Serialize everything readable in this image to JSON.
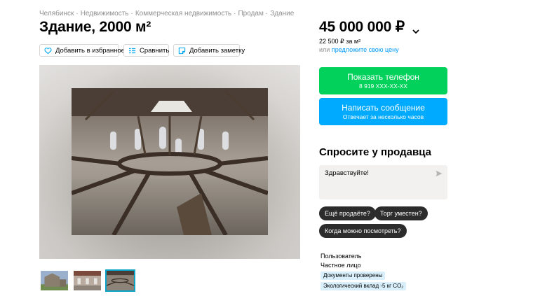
{
  "breadcrumbs": [
    "Челябинск",
    "Недвижимость",
    "Коммерческая недвижимость",
    "Продам",
    "Здание"
  ],
  "breadcrumb_separator": "·",
  "listing": {
    "title": "Здание, 2000 м²",
    "actions": {
      "favorite_label": "Добавить в избранное",
      "compare_label": "Сравнить",
      "note_label": "Добавить заметку"
    },
    "gallery": {
      "thumbnail_count": 3,
      "active_thumbnail": 3
    }
  },
  "pricing": {
    "price": "45 000 000 ₽",
    "price_per_m2": "22 500 ₽ за м²",
    "propose_prefix": "или",
    "propose_link": "предложите свою цену"
  },
  "contact": {
    "phone_label": "Показать телефон",
    "phone_number": "8 919 XXX-XX-XX",
    "message_label": "Написать сообщение",
    "message_sub": "Отвечает за несколько часов"
  },
  "ask_seller": {
    "title": "Спросите у продавца",
    "message_value": "Здравствуйте!",
    "quick_replies": [
      "Ещё продаёте?",
      "Торг уместен?",
      "Когда можно посмотреть?"
    ]
  },
  "seller": {
    "name": "Пользователь",
    "type": "Частное лицо",
    "badges": [
      "Документы проверены",
      "Экологический вклад -5 кг CO₂"
    ]
  },
  "colors": {
    "phone_button": "#02d15c",
    "message_button": "#00aaff",
    "link": "#0099f7",
    "chip": "#2c2c2c",
    "badge": "#d9f0fc",
    "active_thumb_border": "#0aa3c8"
  },
  "icons": [
    "heart-icon",
    "compare-icon",
    "note-icon",
    "chevron-down-icon",
    "send-icon"
  ]
}
